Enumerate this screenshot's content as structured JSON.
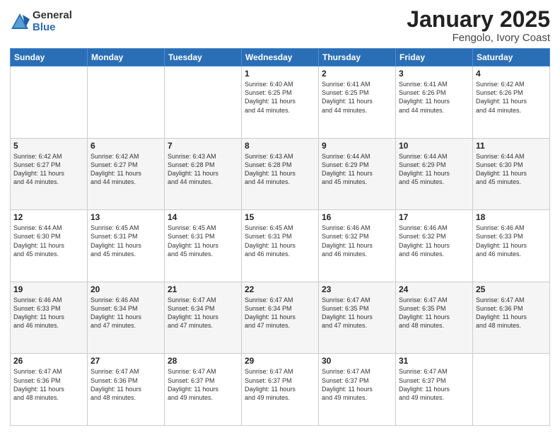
{
  "header": {
    "logo_general": "General",
    "logo_blue": "Blue",
    "month": "January 2025",
    "location": "Fengolo, Ivory Coast"
  },
  "weekdays": [
    "Sunday",
    "Monday",
    "Tuesday",
    "Wednesday",
    "Thursday",
    "Friday",
    "Saturday"
  ],
  "weeks": [
    [
      {
        "day": "",
        "info": ""
      },
      {
        "day": "",
        "info": ""
      },
      {
        "day": "",
        "info": ""
      },
      {
        "day": "1",
        "info": "Sunrise: 6:40 AM\nSunset: 6:25 PM\nDaylight: 11 hours\nand 44 minutes."
      },
      {
        "day": "2",
        "info": "Sunrise: 6:41 AM\nSunset: 6:25 PM\nDaylight: 11 hours\nand 44 minutes."
      },
      {
        "day": "3",
        "info": "Sunrise: 6:41 AM\nSunset: 6:26 PM\nDaylight: 11 hours\nand 44 minutes."
      },
      {
        "day": "4",
        "info": "Sunrise: 6:42 AM\nSunset: 6:26 PM\nDaylight: 11 hours\nand 44 minutes."
      }
    ],
    [
      {
        "day": "5",
        "info": "Sunrise: 6:42 AM\nSunset: 6:27 PM\nDaylight: 11 hours\nand 44 minutes."
      },
      {
        "day": "6",
        "info": "Sunrise: 6:42 AM\nSunset: 6:27 PM\nDaylight: 11 hours\nand 44 minutes."
      },
      {
        "day": "7",
        "info": "Sunrise: 6:43 AM\nSunset: 6:28 PM\nDaylight: 11 hours\nand 44 minutes."
      },
      {
        "day": "8",
        "info": "Sunrise: 6:43 AM\nSunset: 6:28 PM\nDaylight: 11 hours\nand 44 minutes."
      },
      {
        "day": "9",
        "info": "Sunrise: 6:44 AM\nSunset: 6:29 PM\nDaylight: 11 hours\nand 45 minutes."
      },
      {
        "day": "10",
        "info": "Sunrise: 6:44 AM\nSunset: 6:29 PM\nDaylight: 11 hours\nand 45 minutes."
      },
      {
        "day": "11",
        "info": "Sunrise: 6:44 AM\nSunset: 6:30 PM\nDaylight: 11 hours\nand 45 minutes."
      }
    ],
    [
      {
        "day": "12",
        "info": "Sunrise: 6:44 AM\nSunset: 6:30 PM\nDaylight: 11 hours\nand 45 minutes."
      },
      {
        "day": "13",
        "info": "Sunrise: 6:45 AM\nSunset: 6:31 PM\nDaylight: 11 hours\nand 45 minutes."
      },
      {
        "day": "14",
        "info": "Sunrise: 6:45 AM\nSunset: 6:31 PM\nDaylight: 11 hours\nand 45 minutes."
      },
      {
        "day": "15",
        "info": "Sunrise: 6:45 AM\nSunset: 6:31 PM\nDaylight: 11 hours\nand 46 minutes."
      },
      {
        "day": "16",
        "info": "Sunrise: 6:46 AM\nSunset: 6:32 PM\nDaylight: 11 hours\nand 46 minutes."
      },
      {
        "day": "17",
        "info": "Sunrise: 6:46 AM\nSunset: 6:32 PM\nDaylight: 11 hours\nand 46 minutes."
      },
      {
        "day": "18",
        "info": "Sunrise: 6:46 AM\nSunset: 6:33 PM\nDaylight: 11 hours\nand 46 minutes."
      }
    ],
    [
      {
        "day": "19",
        "info": "Sunrise: 6:46 AM\nSunset: 6:33 PM\nDaylight: 11 hours\nand 46 minutes."
      },
      {
        "day": "20",
        "info": "Sunrise: 6:46 AM\nSunset: 6:34 PM\nDaylight: 11 hours\nand 47 minutes."
      },
      {
        "day": "21",
        "info": "Sunrise: 6:47 AM\nSunset: 6:34 PM\nDaylight: 11 hours\nand 47 minutes."
      },
      {
        "day": "22",
        "info": "Sunrise: 6:47 AM\nSunset: 6:34 PM\nDaylight: 11 hours\nand 47 minutes."
      },
      {
        "day": "23",
        "info": "Sunrise: 6:47 AM\nSunset: 6:35 PM\nDaylight: 11 hours\nand 47 minutes."
      },
      {
        "day": "24",
        "info": "Sunrise: 6:47 AM\nSunset: 6:35 PM\nDaylight: 11 hours\nand 48 minutes."
      },
      {
        "day": "25",
        "info": "Sunrise: 6:47 AM\nSunset: 6:36 PM\nDaylight: 11 hours\nand 48 minutes."
      }
    ],
    [
      {
        "day": "26",
        "info": "Sunrise: 6:47 AM\nSunset: 6:36 PM\nDaylight: 11 hours\nand 48 minutes."
      },
      {
        "day": "27",
        "info": "Sunrise: 6:47 AM\nSunset: 6:36 PM\nDaylight: 11 hours\nand 48 minutes."
      },
      {
        "day": "28",
        "info": "Sunrise: 6:47 AM\nSunset: 6:37 PM\nDaylight: 11 hours\nand 49 minutes."
      },
      {
        "day": "29",
        "info": "Sunrise: 6:47 AM\nSunset: 6:37 PM\nDaylight: 11 hours\nand 49 minutes."
      },
      {
        "day": "30",
        "info": "Sunrise: 6:47 AM\nSunset: 6:37 PM\nDaylight: 11 hours\nand 49 minutes."
      },
      {
        "day": "31",
        "info": "Sunrise: 6:47 AM\nSunset: 6:37 PM\nDaylight: 11 hours\nand 49 minutes."
      },
      {
        "day": "",
        "info": ""
      }
    ]
  ]
}
